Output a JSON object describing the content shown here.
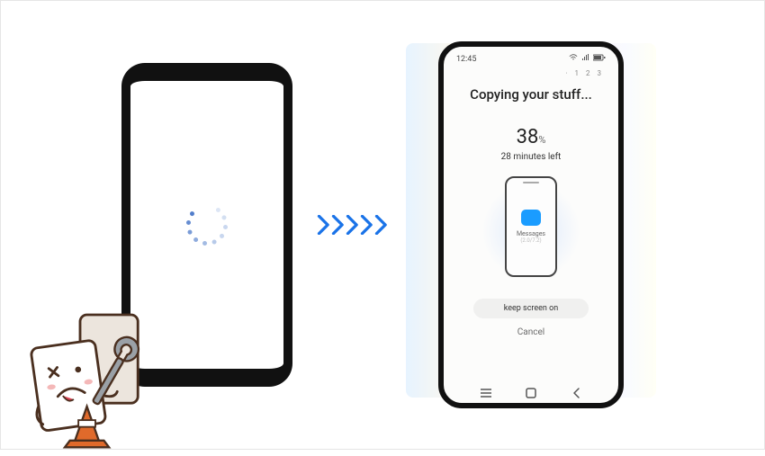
{
  "source_phone": {
    "state": "loading"
  },
  "destination_phone": {
    "statusbar": {
      "time": "12:45"
    },
    "step_indicator": "· 1 2 3",
    "title": "Copying your stuff...",
    "progress": {
      "percent_value": "38",
      "percent_suffix": "%",
      "remaining": "28 minutes left"
    },
    "current_item": {
      "label": "Messages",
      "sublabel": "(2.0/7.2)"
    },
    "keep_screen_button": "keep screen on",
    "cancel_link": "Cancel"
  }
}
